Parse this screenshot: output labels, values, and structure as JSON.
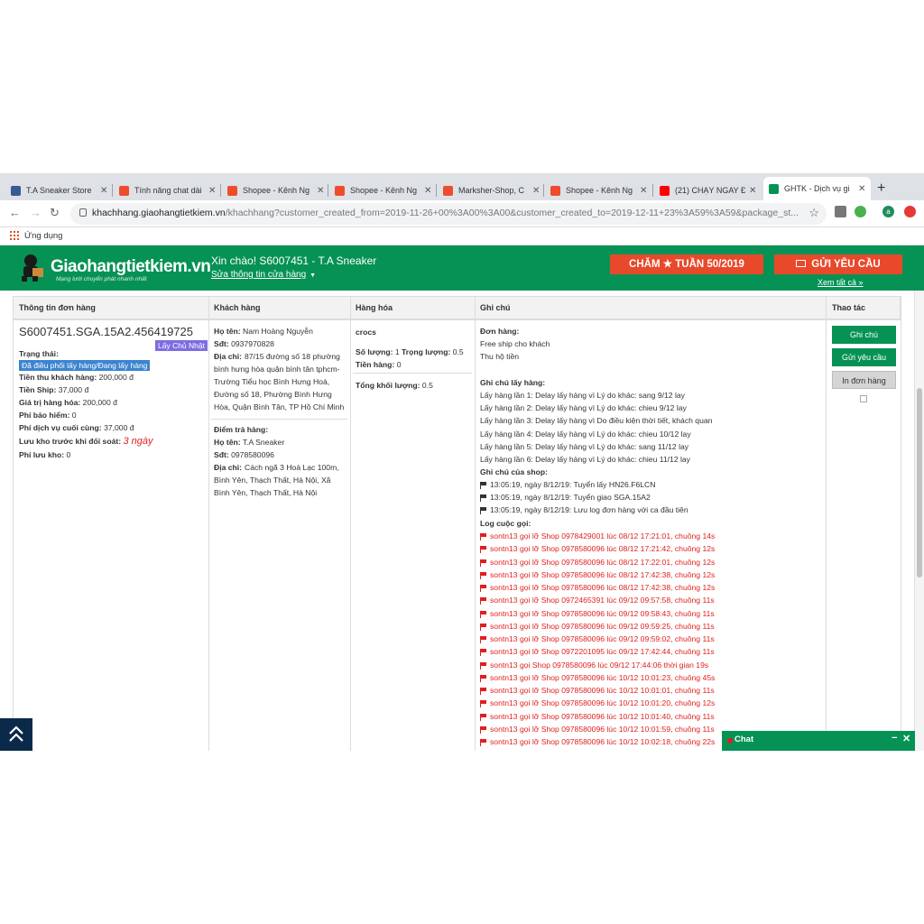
{
  "browser": {
    "tabs": [
      {
        "title": "T.A Sneaker Store",
        "color": "#3b5998"
      },
      {
        "title": "Tính năng chat dài",
        "color": "#ee4d2d"
      },
      {
        "title": "Shopee - Kênh Ng",
        "color": "#ee4d2d"
      },
      {
        "title": "Shopee - Kênh Ng",
        "color": "#ee4d2d"
      },
      {
        "title": "Marksher-Shop, C",
        "color": "#ee4d2d"
      },
      {
        "title": "Shopee - Kênh Ng",
        "color": "#ee4d2d"
      },
      {
        "title": "(21) CHẠY NGAY Đ",
        "color": "#ff0000"
      },
      {
        "title": "GHTK - Dịch vụ gi",
        "color": "#069255"
      }
    ],
    "url_domain": "khachhang.giaohangtietkiem.vn",
    "url_rest": "/khachhang?customer_created_from=2019-11-26+00%3A00%3A00&customer_created_to=2019-12-11+23%3A59%3A59&package_st...",
    "bookmarks_label": "Ứng dụng",
    "profile_initial": "a"
  },
  "header": {
    "logo_text": "Giaohangtietkiem.vn",
    "logo_slogan": "Mạng lưới chuyển phát nhanh nhất",
    "greeting": "Xin chào! S6007451 - T.A Sneaker",
    "edit_shop_link": "Sửa thông tin cửa hàng",
    "week_button": "CHĂM ★ TUẦN 50/2019",
    "request_button": "GỬI YÊU CẦU",
    "see_all": "Xem tất cả »"
  },
  "table": {
    "headers": {
      "order_info": "Thông tin đơn hàng",
      "customer": "Khách hàng",
      "goods": "Hàng hóa",
      "notes": "Ghi chú",
      "actions": "Thao tác"
    },
    "order": {
      "code": "S6007451.SGA.15A2.456419725",
      "pickup_badge": "Lấy Chủ Nhật",
      "status_label": "Trạng thái:",
      "status_value": "Đã điều phối lấy hàng/Đang lấy hàng",
      "collect_label": "Tiền thu khách hàng:",
      "collect_value": "200,000 đ",
      "ship_label": "Tiền Ship:",
      "ship_value": "37,000 đ",
      "goods_value_label": "Giá trị hàng hóa:",
      "goods_value": "200,000 đ",
      "insurance_label": "Phí bảo hiểm:",
      "insurance_value": "0",
      "final_fee_label": "Phí dịch vụ cuối cùng:",
      "final_fee_value": "37,000 đ",
      "storage_label": "Lưu kho trước khi đối soát:",
      "storage_value": "3 ngày",
      "storage_fee_label": "Phí lưu kho:",
      "storage_fee_value": "0"
    },
    "customer": {
      "name_label": "Họ tên:",
      "name": "Nam Hoàng Nguyễn",
      "phone_label": "Sđt:",
      "phone": "0937970828",
      "address_label": "Địa chỉ:",
      "address_lines": [
        "87/15 đường số 18 phường",
        "bình hưng hòa quận bình tân tphcm-",
        "Trường Tiểu học Bình Hưng Hoà,",
        "Đường số 18, Phường Bình Hưng",
        "Hòa, Quận Bình Tân, TP Hồ Chí Minh"
      ],
      "return_point_label": "Điểm trả hàng:",
      "return_name_label": "Họ tên:",
      "return_name": "T.A Sneaker",
      "return_phone_label": "Sđt:",
      "return_phone": "0978580096",
      "return_address_label": "Địa chỉ:",
      "return_address_lines": [
        "Cách ngã 3 Hoà Lạc 100m,",
        "Bình Yên, Thạch Thất, Hà Nội, Xã",
        "Bình Yên, Thạch Thất, Hà Nội"
      ]
    },
    "goods": {
      "name": "crocs",
      "qty_label": "Số lượng:",
      "qty": "1",
      "weight_label": "Trọng lượng:",
      "weight": "0.5",
      "money_label": "Tiền hàng:",
      "money": "0",
      "total_weight_label": "Tổng khối lượng:",
      "total_weight": "0.5"
    },
    "notes": {
      "order_label": "Đơn hàng:",
      "order_lines": [
        "Free ship cho khách",
        "Thu hộ tiền"
      ],
      "pickup_label": "Ghi chú lấy hàng:",
      "pickup_lines": [
        "Lấy hàng lần 1: Delay lấy hàng vì Lý do khác: sang 9/12 lay",
        "Lấy hàng lần 2: Delay lấy hàng vì Lý do khác: chieu 9/12 lay",
        "Lấy hàng lần 3: Delay lấy hàng vì Do điều kiện thời tiết, khách quan",
        "Lấy hàng lần 4: Delay lấy hàng vì Lý do khác: chieu 10/12 lay",
        "Lấy hàng lần 5: Delay lấy hàng vì Lý do khác: sang 11/12 lay",
        "Lấy hàng lần 6: Delay lấy hàng vì Lý do khác: chieu 11/12 lay"
      ],
      "shop_label": "Ghi chú của shop:",
      "shop_lines": [
        "13:05:19, ngày 8/12/19: Tuyển lấy HN26.F6LCN",
        "13:05:19, ngày 8/12/19: Tuyển giao SGA.15A2",
        "13:05:19, ngày 8/12/19: Lưu log đơn hàng với ca đầu tiên"
      ],
      "call_log_label": "Log cuộc gọi:",
      "call_lines": [
        "sontn13 gọi lỡ Shop 0978429001 lúc 08/12 17:21:01, chuông 14s",
        "sontn13 gọi lỡ Shop 0978580096 lúc 08/12 17:21:42, chuông 12s",
        "sontn13 gọi lỡ Shop 0978580096 lúc 08/12 17:22:01, chuông 12s",
        "sontn13 gọi lỡ Shop 0978580096 lúc 08/12 17:42:38, chuông 12s",
        "sontn13 gọi lỡ Shop 0978580096 lúc 08/12 17:42:38, chuông 12s",
        "sontn13 gọi lỡ Shop 0972465391 lúc 09/12 09:57:58, chuông 11s",
        "sontn13 gọi lỡ Shop 0978580096 lúc 09/12 09:58:43, chuông 11s",
        "sontn13 gọi lỡ Shop 0978580096 lúc 09/12 09:59:25, chuông 11s",
        "sontn13 gọi lỡ Shop 0978580096 lúc 09/12 09:59:02, chuông 11s",
        "sontn13 gọi lỡ Shop 0972201095 lúc 09/12 17:42:44, chuông 11s",
        "sontn13 gọi Shop 0978580096 lúc 09/12 17:44:06 thời gian 19s",
        "sontn13 gọi lỡ Shop 0978580096 lúc 10/12 10:01:23, chuông 45s",
        "sontn13 gọi lỡ Shop 0978580096 lúc 10/12 10:01:01, chuông 11s",
        "sontn13 gọi lỡ Shop 0978580096 lúc 10/12 10:01:20, chuông 12s",
        "sontn13 gọi lỡ Shop 0978580096 lúc 10/12 10:01:40, chuông 11s",
        "sontn13 gọi lỡ Shop 0978580096 lúc 10/12 10:01:59, chuông 11s",
        "sontn13 gọi lỡ Shop 0978580096 lúc 10/12 10:02:18, chuông 22s"
      ]
    },
    "actions": {
      "note_button": "Ghi chú",
      "request_button": "Gửi yêu cầu",
      "print_button": "In đơn hàng"
    }
  },
  "chat": {
    "label": "Chat",
    "min": "−",
    "close": "✕"
  },
  "colors": {
    "brand_green": "#069255",
    "accent_red": "#e8492b",
    "call_red": "#e01f1f"
  }
}
